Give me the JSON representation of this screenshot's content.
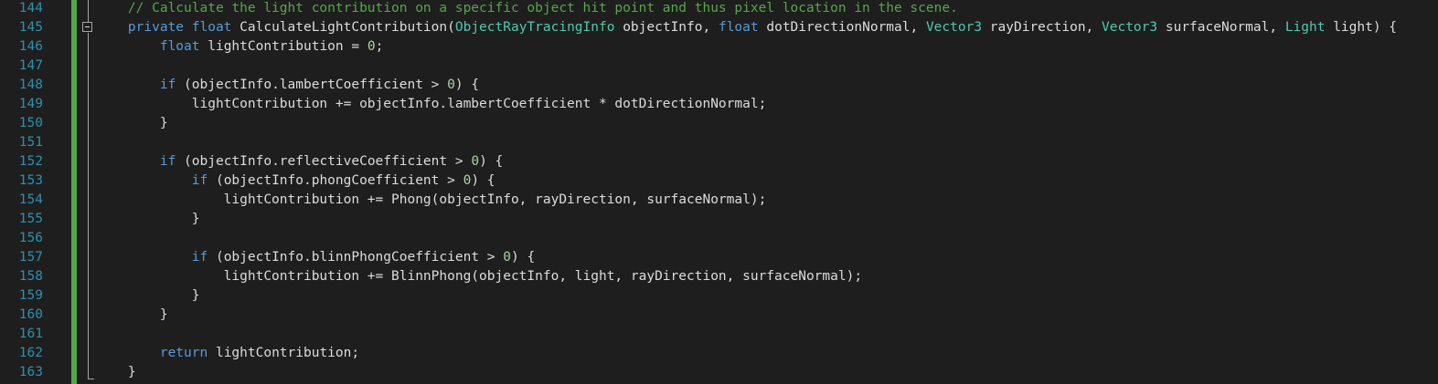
{
  "editor": {
    "colors": {
      "background": "#1e1e1e",
      "line_number": "#2b91af",
      "keyword": "#569cd6",
      "type": "#4ec9b0",
      "comment": "#57a64a",
      "number": "#b5cea8",
      "plain": "#dcdcdc",
      "change_bar": "#57a64a"
    },
    "lines": [
      {
        "num": "144",
        "tokens": [
          {
            "t": "    // Calculate the light contribution on a specific object hit point and thus pixel location in the scene.",
            "c": "cm"
          }
        ]
      },
      {
        "num": "145",
        "tokens": [
          {
            "t": "    ",
            "c": "pl"
          },
          {
            "t": "private",
            "c": "kw"
          },
          {
            "t": " ",
            "c": "pl"
          },
          {
            "t": "float",
            "c": "kw"
          },
          {
            "t": " CalculateLightContribution(",
            "c": "pl"
          },
          {
            "t": "ObjectRayTracingInfo",
            "c": "ty"
          },
          {
            "t": " objectInfo, ",
            "c": "pl"
          },
          {
            "t": "float",
            "c": "kw"
          },
          {
            "t": " dotDirectionNormal, ",
            "c": "pl"
          },
          {
            "t": "Vector3",
            "c": "ty"
          },
          {
            "t": " rayDirection, ",
            "c": "pl"
          },
          {
            "t": "Vector3",
            "c": "ty"
          },
          {
            "t": " surfaceNormal, ",
            "c": "pl"
          },
          {
            "t": "Light",
            "c": "ty"
          },
          {
            "t": " light) {",
            "c": "pl"
          }
        ]
      },
      {
        "num": "146",
        "tokens": [
          {
            "t": "        ",
            "c": "pl"
          },
          {
            "t": "float",
            "c": "kw"
          },
          {
            "t": " lightContribution = ",
            "c": "pl"
          },
          {
            "t": "0",
            "c": "num"
          },
          {
            "t": ";",
            "c": "pl"
          }
        ]
      },
      {
        "num": "147",
        "tokens": []
      },
      {
        "num": "148",
        "tokens": [
          {
            "t": "        ",
            "c": "pl"
          },
          {
            "t": "if",
            "c": "kw"
          },
          {
            "t": " (objectInfo.lambertCoefficient > ",
            "c": "pl"
          },
          {
            "t": "0",
            "c": "num"
          },
          {
            "t": ") {",
            "c": "pl"
          }
        ]
      },
      {
        "num": "149",
        "tokens": [
          {
            "t": "            lightContribution += objectInfo.lambertCoefficient * dotDirectionNormal;",
            "c": "pl"
          }
        ]
      },
      {
        "num": "150",
        "tokens": [
          {
            "t": "        }",
            "c": "pl"
          }
        ]
      },
      {
        "num": "151",
        "tokens": []
      },
      {
        "num": "152",
        "tokens": [
          {
            "t": "        ",
            "c": "pl"
          },
          {
            "t": "if",
            "c": "kw"
          },
          {
            "t": " (objectInfo.reflectiveCoefficient > ",
            "c": "pl"
          },
          {
            "t": "0",
            "c": "num"
          },
          {
            "t": ") {",
            "c": "pl"
          }
        ]
      },
      {
        "num": "153",
        "tokens": [
          {
            "t": "            ",
            "c": "pl"
          },
          {
            "t": "if",
            "c": "kw"
          },
          {
            "t": " (objectInfo.phongCoefficient > ",
            "c": "pl"
          },
          {
            "t": "0",
            "c": "num"
          },
          {
            "t": ") {",
            "c": "pl"
          }
        ]
      },
      {
        "num": "154",
        "tokens": [
          {
            "t": "                lightContribution += Phong(objectInfo, rayDirection, surfaceNormal);",
            "c": "pl"
          }
        ]
      },
      {
        "num": "155",
        "tokens": [
          {
            "t": "            }",
            "c": "pl"
          }
        ]
      },
      {
        "num": "156",
        "tokens": []
      },
      {
        "num": "157",
        "tokens": [
          {
            "t": "            ",
            "c": "pl"
          },
          {
            "t": "if",
            "c": "kw"
          },
          {
            "t": " (objectInfo.blinnPhongCoefficient > ",
            "c": "pl"
          },
          {
            "t": "0",
            "c": "num"
          },
          {
            "t": ") {",
            "c": "pl"
          }
        ]
      },
      {
        "num": "158",
        "tokens": [
          {
            "t": "                lightContribution += BlinnPhong(objectInfo, light, rayDirection, surfaceNormal);",
            "c": "pl"
          }
        ]
      },
      {
        "num": "159",
        "tokens": [
          {
            "t": "            }",
            "c": "pl"
          }
        ]
      },
      {
        "num": "160",
        "tokens": [
          {
            "t": "        }",
            "c": "pl"
          }
        ]
      },
      {
        "num": "161",
        "tokens": []
      },
      {
        "num": "162",
        "tokens": [
          {
            "t": "        ",
            "c": "pl"
          },
          {
            "t": "return",
            "c": "kw"
          },
          {
            "t": " lightContribution;",
            "c": "pl"
          }
        ]
      },
      {
        "num": "163",
        "tokens": [
          {
            "t": "    }",
            "c": "pl"
          }
        ]
      }
    ]
  }
}
